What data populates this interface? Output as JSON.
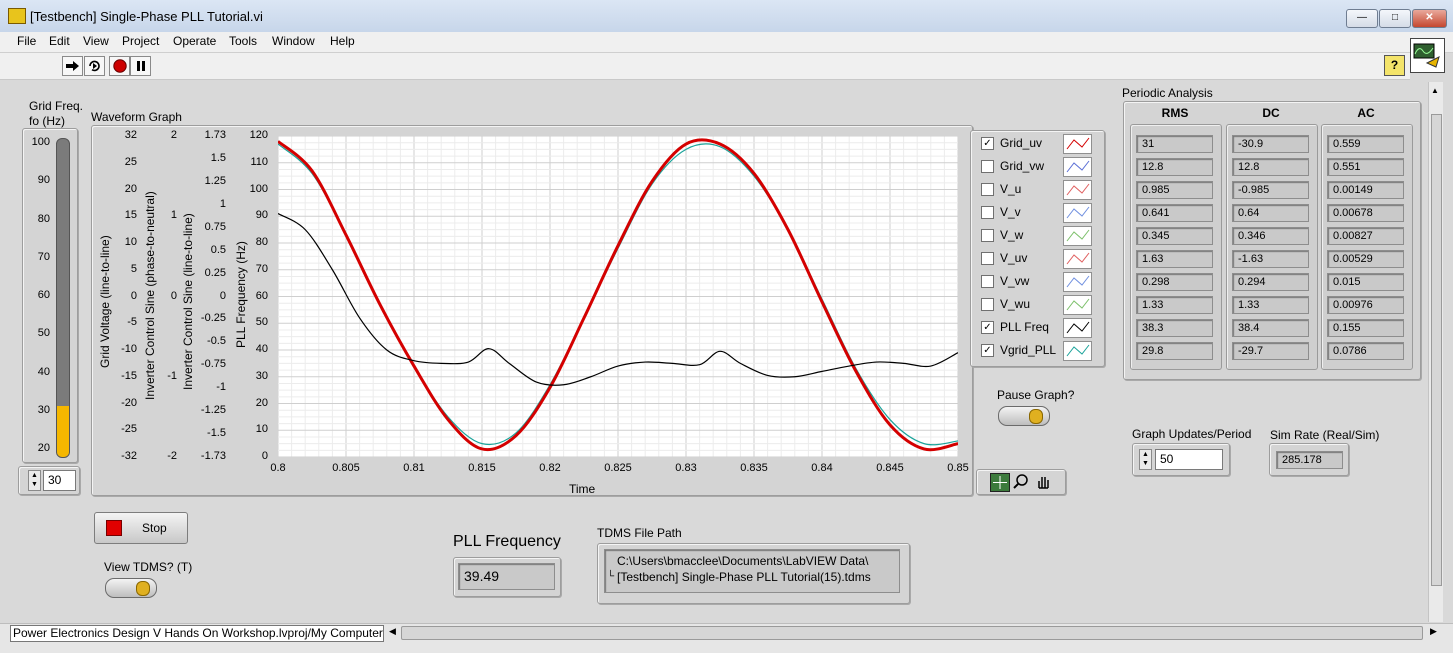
{
  "window": {
    "title": "[Testbench] Single-Phase PLL Tutorial.vi",
    "minimize_glyph": "—",
    "maximize_glyph": "□",
    "close_glyph": "✕"
  },
  "menu": [
    "File",
    "Edit",
    "View",
    "Project",
    "Operate",
    "Tools",
    "Window",
    "Help"
  ],
  "toolbar": {
    "run_icon": "run-arrow-icon",
    "run_continuous_icon": "run-continuously-icon",
    "abort_icon": "abort-icon",
    "pause_icon": "pause-icon",
    "help_glyph": "?"
  },
  "grid_freq": {
    "label_line1": "Grid Freq.",
    "label_line2": "fo (Hz)",
    "ticks": [
      "100",
      "90",
      "80",
      "70",
      "60",
      "50",
      "40",
      "30",
      "20"
    ],
    "scale_min": 17,
    "scale_max": 100,
    "value_fraction_of_scale": 0.16,
    "control_value": "30",
    "fill_color": "#f5b700"
  },
  "graph": {
    "title": "Waveform Graph",
    "axis1_ticks": [
      "32",
      "25",
      "20",
      "15",
      "10",
      "5",
      "0",
      "-5",
      "-10",
      "-15",
      "-20",
      "-25",
      "-32"
    ],
    "axis1_label": "Grid Voltage (line-to-line)",
    "axis2_ticks": [
      "2",
      "1",
      "0",
      "-1",
      "-2"
    ],
    "axis2_label": "Inverter Control Sine (phase-to-neutral)",
    "axis3_ticks": [
      "1.73",
      "1.5",
      "1.25",
      "1",
      "0.75",
      "0.5",
      "0.25",
      "0",
      "-0.25",
      "-0.5",
      "-0.75",
      "-1",
      "-1.25",
      "-1.5",
      "-1.73"
    ],
    "axis3_label": "Inverter Control Sine (line-to-line)",
    "axis4_ticks": [
      "120",
      "110",
      "100",
      "90",
      "80",
      "70",
      "60",
      "50",
      "40",
      "30",
      "20",
      "10",
      "0"
    ],
    "axis4_label": "PLL Frequency (Hz)",
    "x_ticks": [
      "0.8",
      "0.805",
      "0.81",
      "0.815",
      "0.82",
      "0.825",
      "0.83",
      "0.835",
      "0.84",
      "0.845",
      "0.85"
    ],
    "x_label": "Time"
  },
  "chart_data": {
    "type": "line",
    "xlim": [
      0.8,
      0.85
    ],
    "ylim": [
      0,
      120
    ],
    "xlabel": "Time",
    "ylabel": "PLL Frequency (Hz)",
    "grid": true,
    "series": [
      {
        "name": "PLL Freq",
        "color": "#000000",
        "x": [
          0.8,
          0.802,
          0.804,
          0.806,
          0.808,
          0.81,
          0.812,
          0.814,
          0.8155,
          0.817,
          0.819,
          0.821,
          0.823,
          0.825,
          0.827,
          0.829,
          0.831,
          0.8325,
          0.834,
          0.836,
          0.838,
          0.84,
          0.842,
          0.844,
          0.846,
          0.848,
          0.85
        ],
        "y": [
          91,
          85,
          70,
          52,
          40,
          36,
          35,
          35.5,
          40.5,
          35,
          28,
          27,
          30,
          34,
          35.5,
          35,
          34.5,
          39.5,
          35,
          30.5,
          30,
          32,
          34,
          35.5,
          35,
          34,
          39
        ]
      },
      {
        "name": "Grid_uv",
        "color": "#d40000",
        "x": [
          0.8,
          0.8025,
          0.805,
          0.8075,
          0.81,
          0.8125,
          0.815,
          0.8175,
          0.82,
          0.8225,
          0.825,
          0.8275,
          0.83,
          0.8325,
          0.835,
          0.8375,
          0.84,
          0.8425,
          0.845,
          0.8475,
          0.85
        ],
        "y": [
          118,
          107,
          83,
          57,
          34,
          14,
          3,
          8,
          26,
          52,
          79,
          103,
          117,
          117,
          106,
          85,
          58,
          32,
          12,
          3,
          5
        ]
      },
      {
        "name": "Vgrid_PLL",
        "color": "#1aa39a",
        "x": [
          0.8,
          0.8025,
          0.805,
          0.8075,
          0.81,
          0.8125,
          0.815,
          0.8175,
          0.82,
          0.8225,
          0.825,
          0.8275,
          0.83,
          0.8325,
          0.835,
          0.8375,
          0.84,
          0.8425,
          0.845,
          0.8475,
          0.85
        ],
        "y": [
          117,
          106,
          83,
          57,
          34,
          15,
          5,
          9,
          27,
          52,
          78,
          102,
          115,
          116,
          105,
          85,
          59,
          33,
          14,
          5,
          6
        ]
      }
    ]
  },
  "legend": [
    {
      "name": "Grid_uv",
      "checked": true,
      "color": "#d40000"
    },
    {
      "name": "Grid_vw",
      "checked": false,
      "color": "#5b6fd6"
    },
    {
      "name": "V_u",
      "checked": false,
      "color": "#e06060"
    },
    {
      "name": "V_v",
      "checked": false,
      "color": "#6f8fe0"
    },
    {
      "name": "V_w",
      "checked": false,
      "color": "#7cc06a"
    },
    {
      "name": "V_uv",
      "checked": false,
      "color": "#e06060"
    },
    {
      "name": "V_vw",
      "checked": false,
      "color": "#6f8fe0"
    },
    {
      "name": "V_wu",
      "checked": false,
      "color": "#7cc06a"
    },
    {
      "name": "PLL Freq",
      "checked": true,
      "color": "#000000"
    },
    {
      "name": "Vgrid_PLL",
      "checked": true,
      "color": "#1aa39a"
    }
  ],
  "check_glyph": "✓",
  "pause_graph": {
    "label": "Pause Graph?"
  },
  "graph_tools": [
    "crosshair-icon",
    "zoom-icon",
    "pan-hand-icon"
  ],
  "periodic": {
    "title": "Periodic Analysis",
    "columns": [
      {
        "header": "RMS",
        "values": [
          "31",
          "12.8",
          "0.985",
          "0.641",
          "0.345",
          "1.63",
          "0.298",
          "1.33",
          "38.3",
          "29.8"
        ]
      },
      {
        "header": "DC",
        "values": [
          "-30.9",
          "12.8",
          "-0.985",
          "0.64",
          "0.346",
          "-1.63",
          "0.294",
          "1.33",
          "38.4",
          "-29.7"
        ]
      },
      {
        "header": "AC",
        "values": [
          "0.559",
          "0.551",
          "0.00149",
          "0.00678",
          "0.00827",
          "0.00529",
          "0.015",
          "0.00976",
          "0.155",
          "0.0786"
        ]
      }
    ]
  },
  "graph_updates": {
    "label": "Graph Updates/Period",
    "value": "50"
  },
  "sim_rate": {
    "label": "Sim Rate (Real/Sim)",
    "value": "285.178"
  },
  "stop": {
    "label": "Stop"
  },
  "view_tdms": {
    "label": "View TDMS? (T)"
  },
  "pll_frequency": {
    "label": "PLL Frequency",
    "value": "39.49"
  },
  "tdms": {
    "label": "TDMS File Path",
    "line1": "C:\\Users\\bmacclee\\Documents\\LabVIEW Data\\",
    "line2": "[Testbench] Single-Phase PLL Tutorial(15).tdms"
  },
  "statusbar": {
    "project": "Power Electronics Design V Hands On Workshop.lvproj/My Computer"
  },
  "spin_up": "▲",
  "spin_down": "▼"
}
